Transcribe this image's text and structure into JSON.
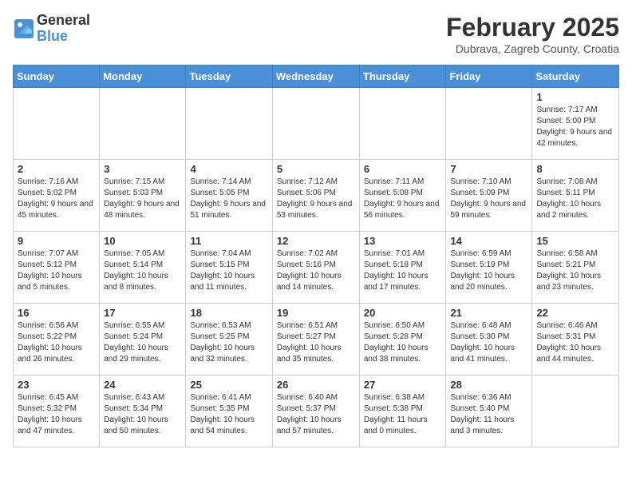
{
  "header": {
    "logo_general": "General",
    "logo_blue": "Blue",
    "month_title": "February 2025",
    "location": "Dubrava, Zagreb County, Croatia"
  },
  "days_of_week": [
    "Sunday",
    "Monday",
    "Tuesday",
    "Wednesday",
    "Thursday",
    "Friday",
    "Saturday"
  ],
  "weeks": [
    [
      {
        "day": "",
        "info": ""
      },
      {
        "day": "",
        "info": ""
      },
      {
        "day": "",
        "info": ""
      },
      {
        "day": "",
        "info": ""
      },
      {
        "day": "",
        "info": ""
      },
      {
        "day": "",
        "info": ""
      },
      {
        "day": "1",
        "info": "Sunrise: 7:17 AM\nSunset: 5:00 PM\nDaylight: 9 hours and 42 minutes."
      }
    ],
    [
      {
        "day": "2",
        "info": "Sunrise: 7:16 AM\nSunset: 5:02 PM\nDaylight: 9 hours and 45 minutes."
      },
      {
        "day": "3",
        "info": "Sunrise: 7:15 AM\nSunset: 5:03 PM\nDaylight: 9 hours and 48 minutes."
      },
      {
        "day": "4",
        "info": "Sunrise: 7:14 AM\nSunset: 5:05 PM\nDaylight: 9 hours and 51 minutes."
      },
      {
        "day": "5",
        "info": "Sunrise: 7:12 AM\nSunset: 5:06 PM\nDaylight: 9 hours and 53 minutes."
      },
      {
        "day": "6",
        "info": "Sunrise: 7:11 AM\nSunset: 5:08 PM\nDaylight: 9 hours and 56 minutes."
      },
      {
        "day": "7",
        "info": "Sunrise: 7:10 AM\nSunset: 5:09 PM\nDaylight: 9 hours and 59 minutes."
      },
      {
        "day": "8",
        "info": "Sunrise: 7:08 AM\nSunset: 5:11 PM\nDaylight: 10 hours and 2 minutes."
      }
    ],
    [
      {
        "day": "9",
        "info": "Sunrise: 7:07 AM\nSunset: 5:12 PM\nDaylight: 10 hours and 5 minutes."
      },
      {
        "day": "10",
        "info": "Sunrise: 7:05 AM\nSunset: 5:14 PM\nDaylight: 10 hours and 8 minutes."
      },
      {
        "day": "11",
        "info": "Sunrise: 7:04 AM\nSunset: 5:15 PM\nDaylight: 10 hours and 11 minutes."
      },
      {
        "day": "12",
        "info": "Sunrise: 7:02 AM\nSunset: 5:16 PM\nDaylight: 10 hours and 14 minutes."
      },
      {
        "day": "13",
        "info": "Sunrise: 7:01 AM\nSunset: 5:18 PM\nDaylight: 10 hours and 17 minutes."
      },
      {
        "day": "14",
        "info": "Sunrise: 6:59 AM\nSunset: 5:19 PM\nDaylight: 10 hours and 20 minutes."
      },
      {
        "day": "15",
        "info": "Sunrise: 6:58 AM\nSunset: 5:21 PM\nDaylight: 10 hours and 23 minutes."
      }
    ],
    [
      {
        "day": "16",
        "info": "Sunrise: 6:56 AM\nSunset: 5:22 PM\nDaylight: 10 hours and 26 minutes."
      },
      {
        "day": "17",
        "info": "Sunrise: 6:55 AM\nSunset: 5:24 PM\nDaylight: 10 hours and 29 minutes."
      },
      {
        "day": "18",
        "info": "Sunrise: 6:53 AM\nSunset: 5:25 PM\nDaylight: 10 hours and 32 minutes."
      },
      {
        "day": "19",
        "info": "Sunrise: 6:51 AM\nSunset: 5:27 PM\nDaylight: 10 hours and 35 minutes."
      },
      {
        "day": "20",
        "info": "Sunrise: 6:50 AM\nSunset: 5:28 PM\nDaylight: 10 hours and 38 minutes."
      },
      {
        "day": "21",
        "info": "Sunrise: 6:48 AM\nSunset: 5:30 PM\nDaylight: 10 hours and 41 minutes."
      },
      {
        "day": "22",
        "info": "Sunrise: 6:46 AM\nSunset: 5:31 PM\nDaylight: 10 hours and 44 minutes."
      }
    ],
    [
      {
        "day": "23",
        "info": "Sunrise: 6:45 AM\nSunset: 5:32 PM\nDaylight: 10 hours and 47 minutes."
      },
      {
        "day": "24",
        "info": "Sunrise: 6:43 AM\nSunset: 5:34 PM\nDaylight: 10 hours and 50 minutes."
      },
      {
        "day": "25",
        "info": "Sunrise: 6:41 AM\nSunset: 5:35 PM\nDaylight: 10 hours and 54 minutes."
      },
      {
        "day": "26",
        "info": "Sunrise: 6:40 AM\nSunset: 5:37 PM\nDaylight: 10 hours and 57 minutes."
      },
      {
        "day": "27",
        "info": "Sunrise: 6:38 AM\nSunset: 5:38 PM\nDaylight: 11 hours and 0 minutes."
      },
      {
        "day": "28",
        "info": "Sunrise: 6:36 AM\nSunset: 5:40 PM\nDaylight: 11 hours and 3 minutes."
      },
      {
        "day": "",
        "info": ""
      }
    ]
  ]
}
